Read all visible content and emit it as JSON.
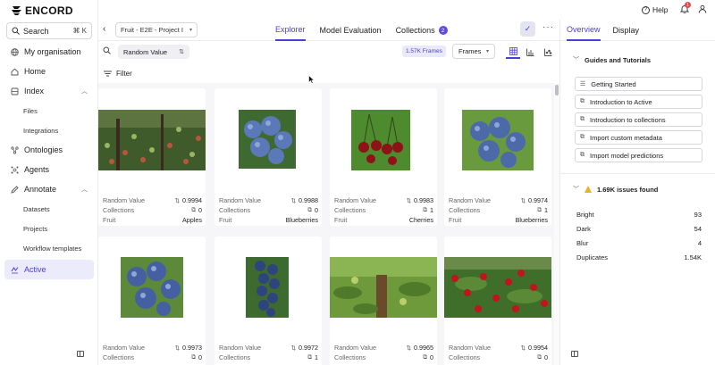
{
  "app": {
    "logo_text": "ENCORD"
  },
  "header": {
    "help_label": "Help",
    "notification_count": "1"
  },
  "sidebar": {
    "search_label": "Search",
    "search_shortcut": "⌘ K",
    "items": [
      {
        "label": "My organisation",
        "icon": "org-icon"
      },
      {
        "label": "Home",
        "icon": "home-icon"
      },
      {
        "label": "Index",
        "icon": "index-icon",
        "expanded": true
      },
      {
        "label": "Files"
      },
      {
        "label": "Integrations"
      },
      {
        "label": "Ontologies",
        "icon": "ontology-icon"
      },
      {
        "label": "Agents",
        "icon": "agents-icon"
      },
      {
        "label": "Annotate",
        "icon": "annotate-icon",
        "expanded": true
      },
      {
        "label": "Datasets"
      },
      {
        "label": "Projects"
      },
      {
        "label": "Workflow templates"
      },
      {
        "label": "Active",
        "icon": "active-icon",
        "selected": true
      }
    ]
  },
  "topbar": {
    "project_name": "Fruit - E2E - Project I",
    "tabs": [
      {
        "label": "Explorer",
        "active": true
      },
      {
        "label": "Model Evaluation"
      },
      {
        "label": "Collections",
        "badge": "2"
      }
    ]
  },
  "toolbar": {
    "sort_chip": "Random Value",
    "frames_count": "1.57K Frames",
    "frames_select": "Frames",
    "filter_label": "Filter"
  },
  "grid": {
    "labels": {
      "random": "Random Value",
      "collections": "Collections",
      "fruit": "Fruit"
    },
    "cards": [
      {
        "random": "0.9994",
        "collections": "0",
        "fruit": "Apples"
      },
      {
        "random": "0.9988",
        "collections": "0",
        "fruit": "Blueberries"
      },
      {
        "random": "0.9983",
        "collections": "1",
        "fruit": "Cherries"
      },
      {
        "random": "0.9974",
        "collections": "1",
        "fruit": "Blueberries"
      },
      {
        "random": "0.9973",
        "collections": "0"
      },
      {
        "random": "0.9972",
        "collections": "1"
      },
      {
        "random": "0.9965",
        "collections": "0"
      },
      {
        "random": "0.9954",
        "collections": "0"
      }
    ]
  },
  "rpanel": {
    "tabs": [
      {
        "label": "Overview",
        "active": true
      },
      {
        "label": "Display"
      }
    ],
    "guides_title": "Guides and Tutorials",
    "guides": [
      {
        "label": "Getting Started",
        "icon": "list-icon"
      },
      {
        "label": "Introduction to Active",
        "icon": "external-link-icon"
      },
      {
        "label": "Introduction to collections",
        "icon": "external-link-icon"
      },
      {
        "label": "Import custom metadata",
        "icon": "external-link-icon"
      },
      {
        "label": "Import model predictions",
        "icon": "external-link-icon"
      }
    ],
    "issues_title": "1.69K issues found",
    "issues": [
      {
        "label": "Bright",
        "value": "93"
      },
      {
        "label": "Dark",
        "value": "54"
      },
      {
        "label": "Blur",
        "value": "4"
      },
      {
        "label": "Duplicates",
        "value": "1.54K"
      }
    ]
  },
  "colors": {
    "accent": "#4b3fd8",
    "warning": "#f2b01e",
    "badge_red": "#e5484d"
  }
}
